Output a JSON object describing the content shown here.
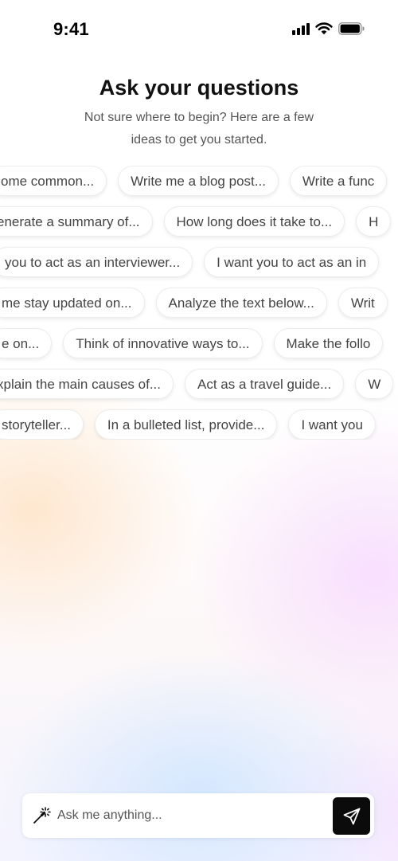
{
  "status_bar": {
    "time": "9:41"
  },
  "header": {
    "title": "Ask your questions",
    "subtitle": "Not sure where to begin? Here are a few ideas to get you started."
  },
  "suggestion_rows": [
    [
      "ome common...",
      "Write me a blog post...",
      "Write a func"
    ],
    [
      "enerate a summary of...",
      "How long does it take to...",
      "H"
    ],
    [
      "you to act as an interviewer...",
      "I want you to act as an in"
    ],
    [
      "me stay updated on...",
      "Analyze the text below...",
      "Writ"
    ],
    [
      "e on...",
      "Think of innovative ways to...",
      "Make the follo"
    ],
    [
      "xplain the main causes of...",
      "Act as a travel guide...",
      "W"
    ],
    [
      "storyteller...",
      "In a bulleted list, provide...",
      "I want you"
    ]
  ],
  "composer": {
    "placeholder": "Ask me anything..."
  },
  "icons": {
    "magic": "magic-wand-icon",
    "send": "send-icon",
    "signal": "cellular-signal-icon",
    "wifi": "wifi-icon",
    "battery": "battery-icon"
  }
}
